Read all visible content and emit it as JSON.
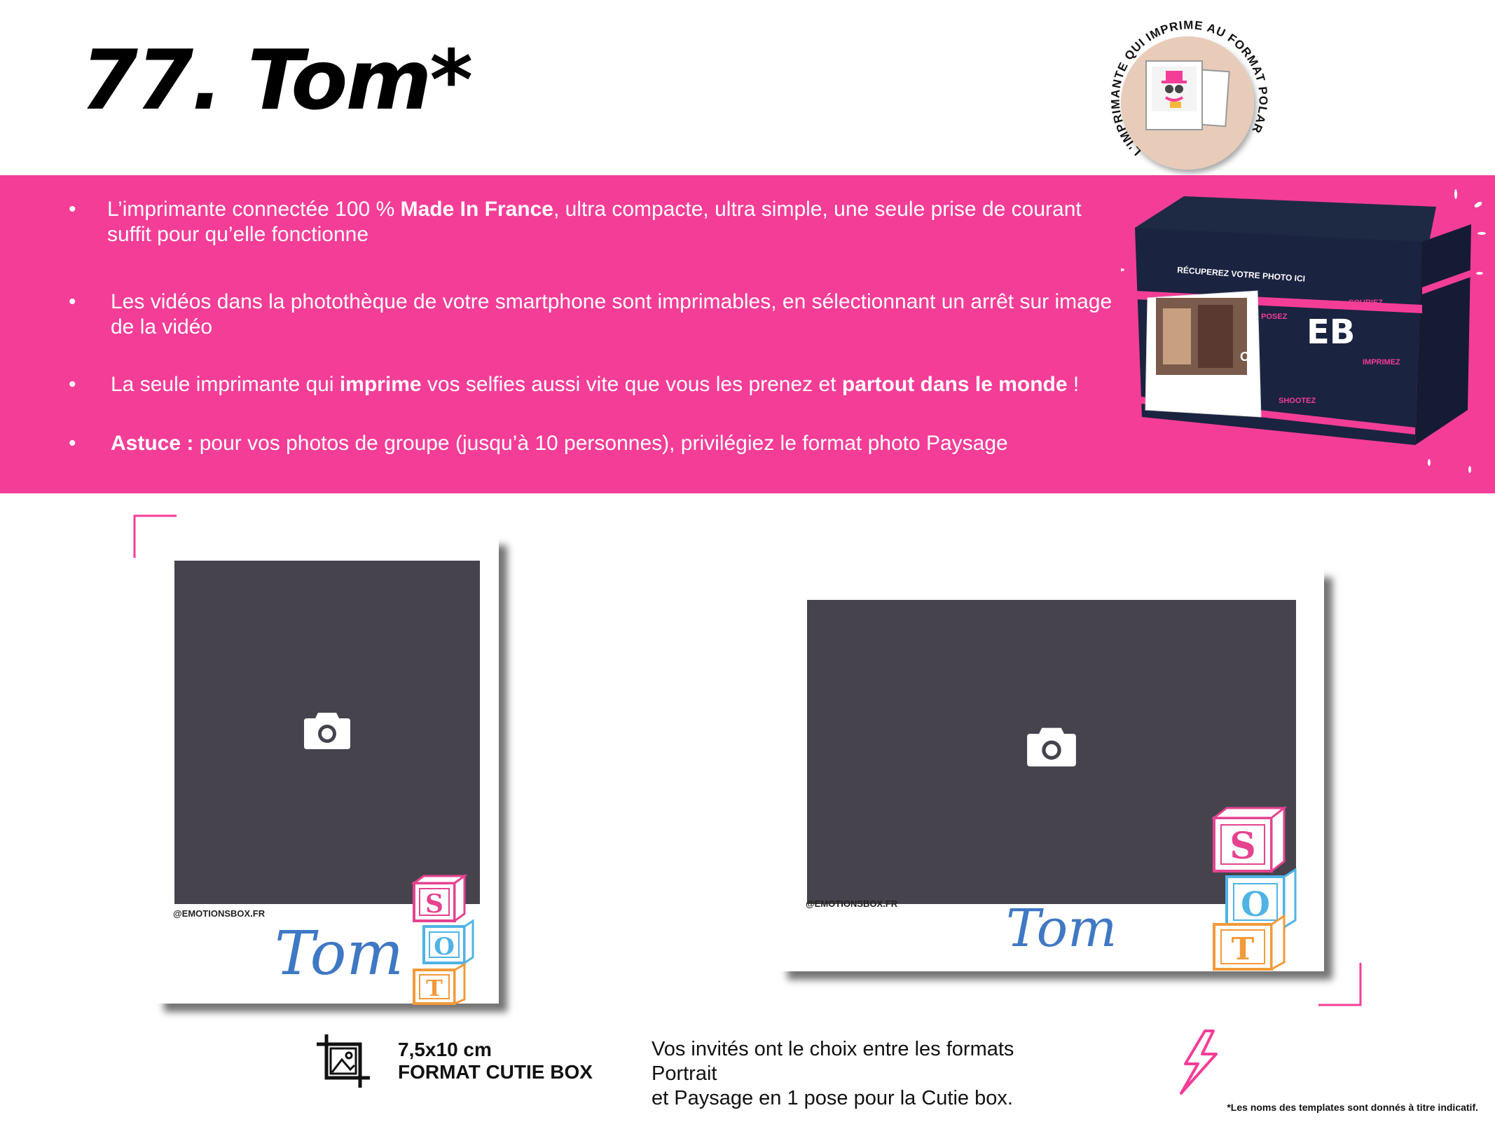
{
  "page": {
    "title": "77.  Tom*"
  },
  "badge": {
    "curved_text": "L'IMPRIMANTE QUI IMPRIME AU FORMAT POLAROÏD"
  },
  "features": [
    {
      "bullet": "•",
      "before": "L’imprimante connectée 100 % ",
      "strong": "Made In France",
      "after": ", ultra compacte, ultra simple, une seule prise de courant suffit pour qu’elle fonctionne"
    },
    {
      "bullet": "•",
      "text": "Les vidéos dans la photothèque de votre smartphone sont imprimables, en sélectionnant un arrêt sur image de la vidéo"
    },
    {
      "bullet": "•",
      "before": "La seule imprimante qui ",
      "strong": "imprime",
      "middle": " vos selfies aussi vite que vous les prenez et ",
      "strong2": "partout dans le monde",
      "after": " !"
    },
    {
      "bullet": "•",
      "strong": "Astuce :",
      "after": " pour vos photos de groupe (jusqu’à 10 personnes), privilégiez le format photo Paysage"
    }
  ],
  "printer_image": {
    "label_top": "RÉCUPEREZ VOTRE PHOTO ICI",
    "logo": "EB",
    "words": [
      "POSEZ",
      "SOURIEZ",
      "SHOOTEZ",
      "IMPRIMEZ"
    ],
    "box_text": "OX"
  },
  "templates": {
    "portrait": {
      "handle": "@EMOTIONSBOX.FR",
      "name": "Tom",
      "blocks": [
        "S",
        "O",
        "T"
      ]
    },
    "landscape": {
      "handle": "@EMOTIONSBOX.FR",
      "name": "Tom",
      "blocks": [
        "S",
        "O",
        "T"
      ]
    }
  },
  "format": {
    "icon": "crop-image-icon",
    "size": "7,5x10 cm",
    "name": "FORMAT CUTIE BOX"
  },
  "choice_text": {
    "line1": "Vos invités ont le choix entre les formats Portrait",
    "line2": "et Paysage en 1 pose pour la Cutie box."
  },
  "footnote": "*Les noms des templates sont donnés à titre indicatif.",
  "colors": {
    "brand_pink": "#f43d97",
    "photo_placeholder": "#46434d",
    "script_blue": "#3f78c4",
    "block_pink": "#e5438f",
    "block_blue": "#4fb3e6",
    "block_orange": "#f29a3a"
  }
}
